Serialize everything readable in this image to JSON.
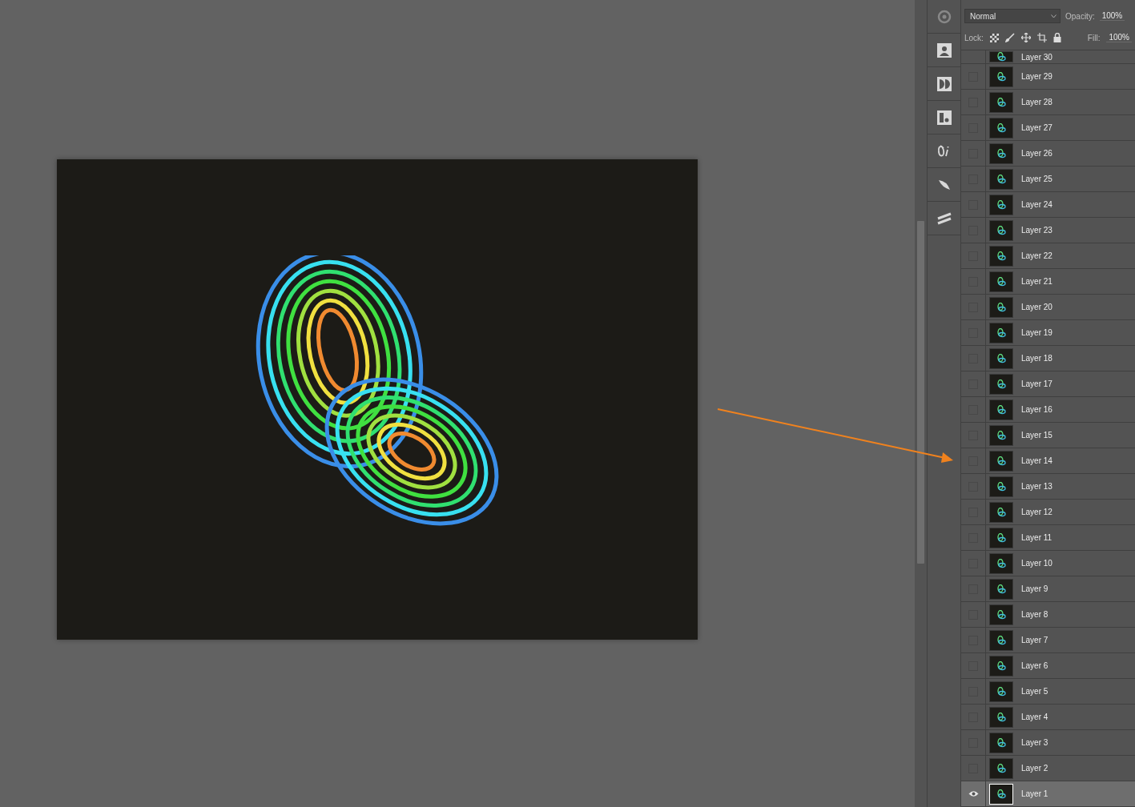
{
  "layers_panel": {
    "blend_mode": "Normal",
    "opacity_label": "Opacity:",
    "opacity_value": "100%",
    "lock_label": "Lock:",
    "fill_label": "Fill:",
    "fill_value": "100%",
    "layers": [
      {
        "name": "Layer 30",
        "visible": false,
        "selected": false
      },
      {
        "name": "Layer 29",
        "visible": false,
        "selected": false
      },
      {
        "name": "Layer 28",
        "visible": false,
        "selected": false
      },
      {
        "name": "Layer 27",
        "visible": false,
        "selected": false
      },
      {
        "name": "Layer 26",
        "visible": false,
        "selected": false
      },
      {
        "name": "Layer 25",
        "visible": false,
        "selected": false
      },
      {
        "name": "Layer 24",
        "visible": false,
        "selected": false
      },
      {
        "name": "Layer 23",
        "visible": false,
        "selected": false
      },
      {
        "name": "Layer 22",
        "visible": false,
        "selected": false
      },
      {
        "name": "Layer 21",
        "visible": false,
        "selected": false
      },
      {
        "name": "Layer 20",
        "visible": false,
        "selected": false
      },
      {
        "name": "Layer 19",
        "visible": false,
        "selected": false
      },
      {
        "name": "Layer 18",
        "visible": false,
        "selected": false
      },
      {
        "name": "Layer 17",
        "visible": false,
        "selected": false
      },
      {
        "name": "Layer 16",
        "visible": false,
        "selected": false
      },
      {
        "name": "Layer 15",
        "visible": false,
        "selected": false
      },
      {
        "name": "Layer 14",
        "visible": false,
        "selected": false
      },
      {
        "name": "Layer 13",
        "visible": false,
        "selected": false
      },
      {
        "name": "Layer 12",
        "visible": false,
        "selected": false
      },
      {
        "name": "Layer 11",
        "visible": false,
        "selected": false
      },
      {
        "name": "Layer 10",
        "visible": false,
        "selected": false
      },
      {
        "name": "Layer 9",
        "visible": false,
        "selected": false
      },
      {
        "name": "Layer 8",
        "visible": false,
        "selected": false
      },
      {
        "name": "Layer 7",
        "visible": false,
        "selected": false
      },
      {
        "name": "Layer 6",
        "visible": false,
        "selected": false
      },
      {
        "name": "Layer 5",
        "visible": false,
        "selected": false
      },
      {
        "name": "Layer 4",
        "visible": false,
        "selected": false
      },
      {
        "name": "Layer 3",
        "visible": false,
        "selected": false
      },
      {
        "name": "Layer 2",
        "visible": false,
        "selected": false
      },
      {
        "name": "Layer 1",
        "visible": true,
        "selected": true
      }
    ]
  }
}
